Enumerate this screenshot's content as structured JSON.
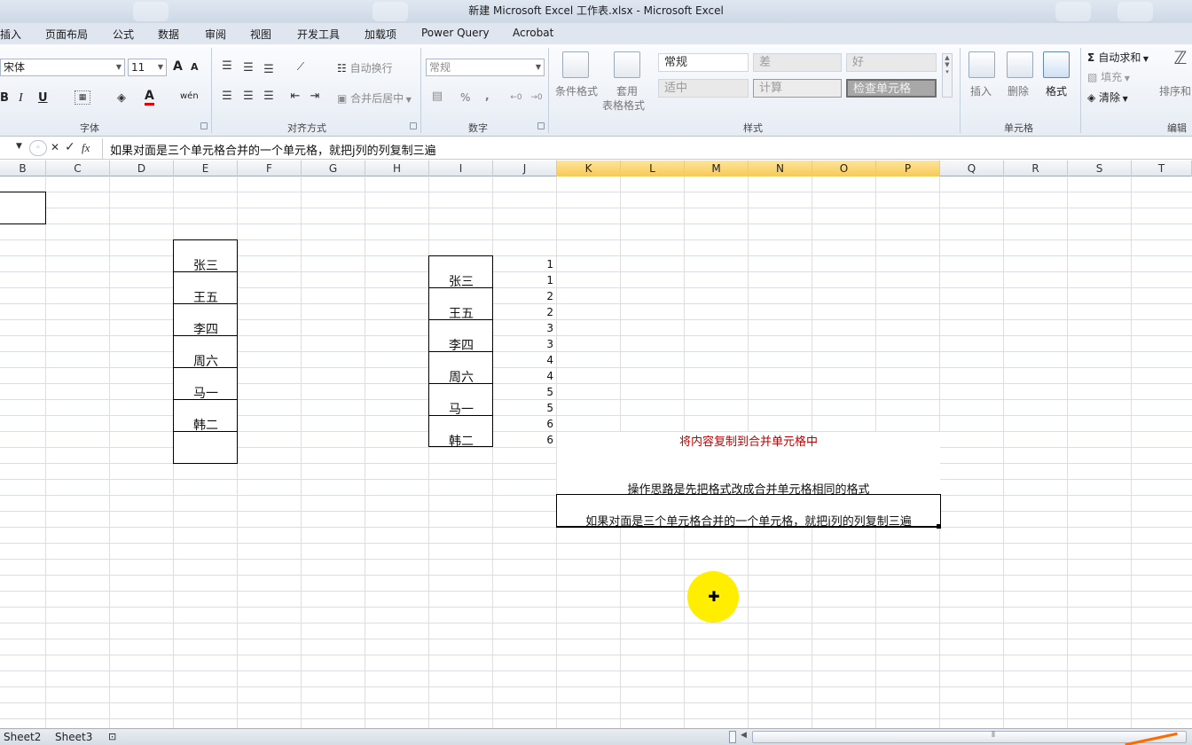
{
  "window": {
    "title": "新建 Microsoft Excel 工作表.xlsx - Microsoft Excel"
  },
  "tabs": [
    "插入",
    "页面布局",
    "公式",
    "数据",
    "审阅",
    "视图",
    "开发工具",
    "加载项",
    "Power Query",
    "Acrobat"
  ],
  "ribbon": {
    "font": {
      "name": "宋体",
      "size": "11",
      "group_label": "字体",
      "bold": "B",
      "italic": "I",
      "underline": "U",
      "grow": "A",
      "shrink": "A",
      "font_color_letter": "A",
      "phonetic": "wén"
    },
    "alignment": {
      "wrap_text": "自动换行",
      "merge_center": "合并后居中",
      "group_label": "对齐方式"
    },
    "number": {
      "format": "常规",
      "percent": "%",
      "comma": ",",
      "group_label": "数字"
    },
    "styles": {
      "conditional_format": "条件格式",
      "table_format_1": "套用",
      "table_format_2": "表格格式",
      "normal": "常规",
      "bad": "差",
      "good": "好",
      "neutral": "适中",
      "calculation": "计算",
      "check_cell": "检查单元格",
      "group_label": "样式"
    },
    "cells": {
      "insert": "插入",
      "delete": "删除",
      "format": "格式",
      "group_label": "单元格"
    },
    "editing": {
      "autosum": "自动求和",
      "fill": "填充",
      "clear": "清除",
      "sort": "排序和",
      "group_label": "编辑"
    }
  },
  "formula_bar": {
    "cancel": "✕",
    "enter": "✓",
    "fx": "fx",
    "content": "如果对面是三个单元格合并的一个单元格，就把j列的列复制三遍"
  },
  "columns": [
    "B",
    "C",
    "D",
    "E",
    "F",
    "G",
    "H",
    "I",
    "J",
    "K",
    "L",
    "M",
    "N",
    "O",
    "P",
    "Q",
    "R",
    "S",
    "T"
  ],
  "selected_columns": [
    "K",
    "L",
    "M",
    "N",
    "O",
    "P"
  ],
  "names_e": [
    "张三",
    "王五",
    "李四",
    "周六",
    "马一",
    "韩二"
  ],
  "names_i": [
    "张三",
    "王五",
    "李四",
    "周六",
    "马一",
    "韩二"
  ],
  "numbers_j": [
    "1",
    "1",
    "2",
    "2",
    "3",
    "3",
    "4",
    "4",
    "5",
    "5",
    "6",
    "6"
  ],
  "notes": {
    "title": "将内容复制到合并单元格中",
    "title_color": "#c00000",
    "idea": "操作思路是先把格式改成合并单元格相同的格式",
    "tip": "如果对面是三个单元格合并的一个单元格，就把j列的列复制三遍"
  },
  "sheets": [
    "Sheet2",
    "Sheet3"
  ],
  "accent": {
    "column_highlight": "#f8c956",
    "cursor_halo": "#ffee00"
  }
}
